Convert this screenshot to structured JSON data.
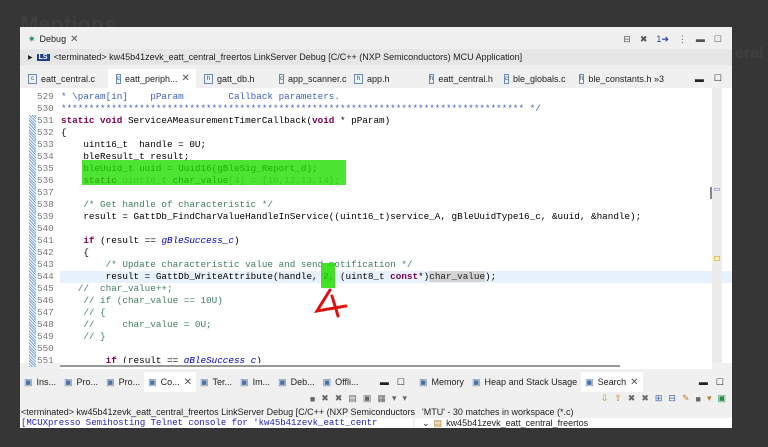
{
  "background_text": [
    "Mentions",
    "eral"
  ],
  "debug_view": {
    "tab": "Debug",
    "launch": "<terminated> kw45b41zevk_eatt_central_freertos LinkServer Debug [C/C++ (NXP Semiconductors) MCU Application]",
    "launch_badge": "LS"
  },
  "editor_tabs": [
    {
      "label": "eatt_central.c",
      "icon": "c"
    },
    {
      "label": "eatt_periph...",
      "icon": "c",
      "active": true
    },
    {
      "label": "gatt_db.h",
      "icon": "h"
    },
    {
      "label": "app_scanner.c",
      "icon": "c"
    },
    {
      "label": "app.h",
      "icon": "h"
    },
    {
      "label": "eatt_central.h",
      "icon": "h"
    },
    {
      "label": "ble_globals.c",
      "icon": "c"
    },
    {
      "label": "ble_constants.h",
      "icon": "h"
    }
  ],
  "more_tabs": "»3",
  "code": [
    {
      "n": "529",
      "t": [
        [
          "* \\param[in]    pParam        Callback parameters.",
          "dc"
        ]
      ]
    },
    {
      "n": "530",
      "t": [
        [
          "*********************************************************************************** */",
          "dc"
        ]
      ]
    },
    {
      "n": "531",
      "t": [
        [
          "static void ",
          "kw"
        ],
        [
          "ServiceAMeasurementTimerCallback(",
          "pl"
        ],
        [
          "void",
          "kw"
        ],
        [
          " * pParam)",
          "pl"
        ]
      ]
    },
    {
      "n": "532",
      "t": [
        [
          "{",
          "pl"
        ]
      ]
    },
    {
      "n": "533",
      "t": [
        [
          "    uint16_t  handle = 0U;",
          "pl"
        ]
      ]
    },
    {
      "n": "534",
      "t": [
        [
          "    bleResult_t result;",
          "pl"
        ]
      ]
    },
    {
      "n": "535",
      "t": [
        [
          "    bleUuid_t uuid = Uuid16(gBleSig_Report_d);",
          "pl"
        ]
      ]
    },
    {
      "n": "536",
      "t": [
        [
          "    static ",
          "kw"
        ],
        [
          "uint16_t ",
          "gr"
        ],
        [
          "char_value",
          "pl"
        ],
        [
          "[4] = {10,12,13,14};",
          "gr"
        ]
      ]
    },
    {
      "n": "537",
      "t": []
    },
    {
      "n": "538",
      "t": [
        [
          "    /* Get handle of characteristic */",
          "cm"
        ]
      ]
    },
    {
      "n": "539",
      "t": [
        [
          "    result = GattDb_FindCharValueHandleInService((uint16_t)service_A, gBleUuidType16_c, &uuid, &handle);",
          "pl"
        ]
      ]
    },
    {
      "n": "540",
      "t": []
    },
    {
      "n": "541",
      "t": [
        [
          "    if",
          "kw"
        ],
        [
          " (result == ",
          "pl"
        ],
        [
          "gBleSuccess_c",
          "st"
        ],
        [
          ")",
          "pl"
        ]
      ]
    },
    {
      "n": "542",
      "t": [
        [
          "    {",
          "pl"
        ]
      ]
    },
    {
      "n": "543",
      "t": [
        [
          "        /* Update characteristic value and send notification */",
          "cm"
        ]
      ]
    },
    {
      "n": "544",
      "hl": true,
      "t": [
        [
          "        result = GattDb_WriteAttribute(handle, 2, (uint8_t ",
          "pl"
        ],
        [
          "const",
          "kw"
        ],
        [
          "*)",
          "pl"
        ],
        [
          "char_value",
          "sel"
        ],
        [
          ");",
          "pl"
        ]
      ]
    },
    {
      "n": "545",
      "t": [
        [
          "   //  char_value++;",
          "cm"
        ]
      ]
    },
    {
      "n": "546",
      "t": [
        [
          "    // if (char_value == 10U)",
          "cm"
        ]
      ]
    },
    {
      "n": "547",
      "t": [
        [
          "    // {",
          "cm"
        ]
      ]
    },
    {
      "n": "548",
      "t": [
        [
          "    //     char_value = 0U;",
          "cm"
        ]
      ]
    },
    {
      "n": "549",
      "t": [
        [
          "    // }",
          "cm"
        ]
      ]
    },
    {
      "n": "550",
      "t": []
    },
    {
      "n": "551",
      "t": [
        [
          "        if",
          "kw"
        ],
        [
          " (result == ",
          "pl"
        ],
        [
          "gBleSuccess_c",
          "st"
        ],
        [
          ")",
          "pl"
        ]
      ]
    }
  ],
  "annotation": "4",
  "bottom_left": {
    "tabs": [
      "Ins...",
      "Pro...",
      "Pro...",
      "Co...",
      "Ter...",
      "Im...",
      "Deb...",
      "Offli..."
    ],
    "active": 3,
    "status": "<terminated> kw45b41zevk_eatt_central_freertos LinkServer Debug [C/C++ (NXP Semiconductors) MCU",
    "console": "[MCUXpresso Semihosting Telnet console for 'kw45b41zevk_eatt_centr"
  },
  "bottom_right": {
    "tabs": [
      "Memory",
      "Heap and Stack Usage",
      "Search"
    ],
    "active": 2,
    "status": "'MTU' - 30 matches in workspace (*.c)",
    "result": "kw45b41zevk_eatt_central_freertos"
  }
}
